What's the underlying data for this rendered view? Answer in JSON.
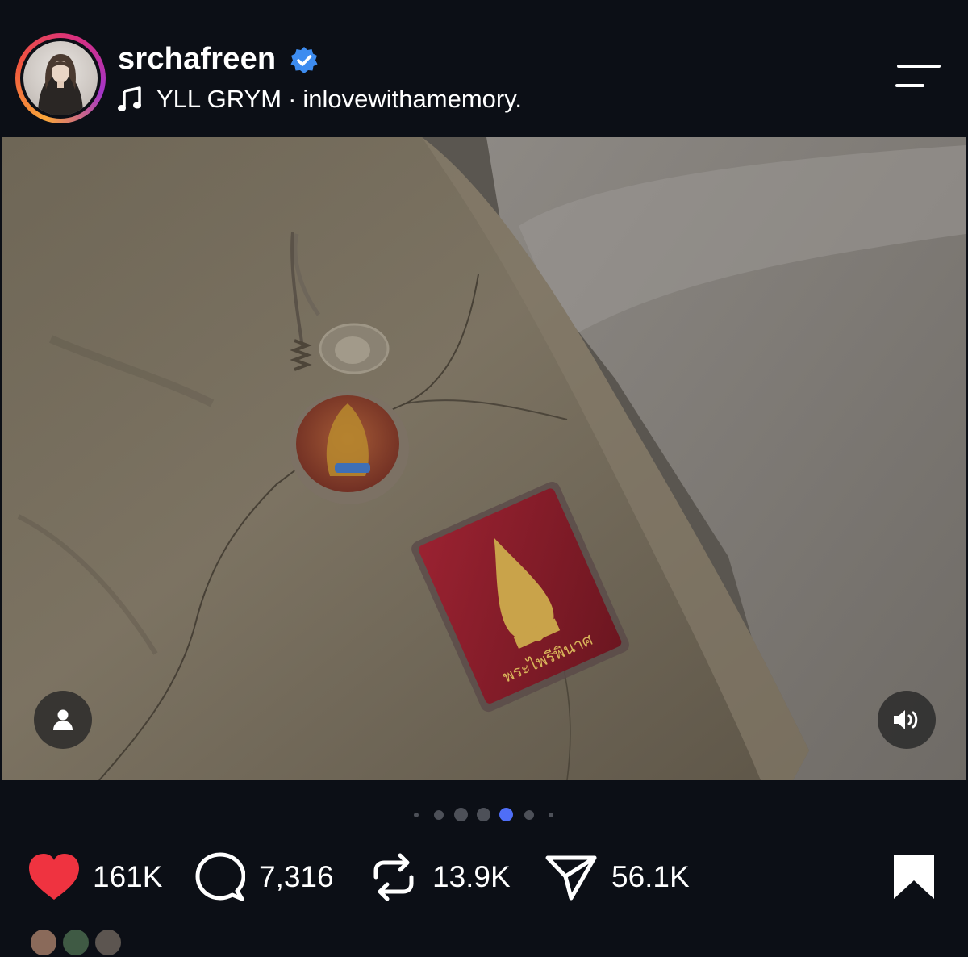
{
  "post": {
    "username": "srchafreen",
    "verified": true,
    "music_artist": "YLL GRYM",
    "music_separator": "·",
    "music_track": "inlovewithamemory."
  },
  "carousel": {
    "total": 7,
    "active": 4
  },
  "actions": {
    "likes": "161K",
    "comments": "7,316",
    "reposts": "13.9K",
    "shares": "56.1K",
    "liked": true,
    "saved": true
  },
  "photo": {
    "box_text": "พระไพรีพินาศ"
  },
  "colors": {
    "background": "#0c0f16",
    "like": "#ef3340",
    "verified": "#3d8cf0",
    "active_dot": "#4f6ef7"
  },
  "icons": [
    "music-note-icon",
    "verified-badge-icon",
    "menu-icon",
    "user-tag-icon",
    "speaker-icon",
    "heart-icon",
    "comment-icon",
    "repost-icon",
    "share-icon",
    "bookmark-icon"
  ]
}
